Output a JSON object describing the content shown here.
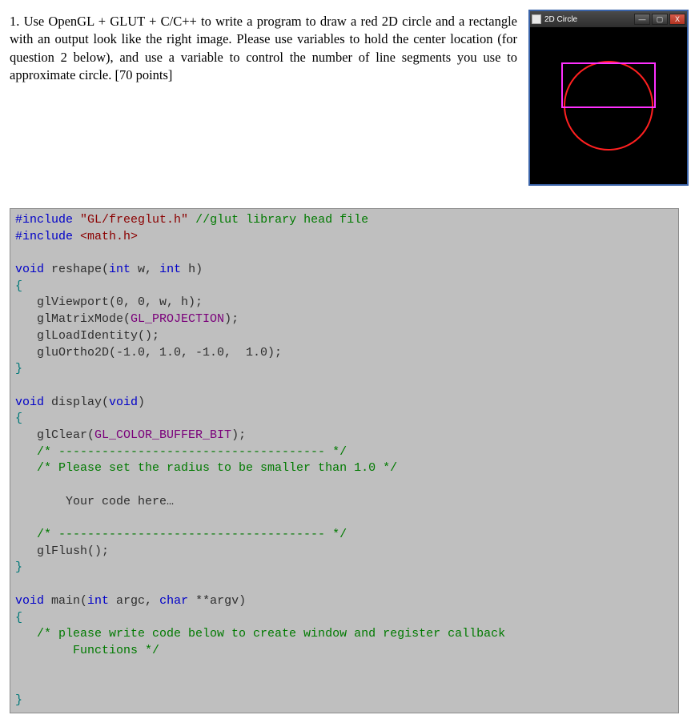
{
  "question": {
    "number": "1.",
    "body": "Use OpenGL + GLUT + C/C++ to write a program to draw a red 2D circle and a rectangle with an output look like the right image. Please use variables to hold the center location (for question 2 below), and use a variable to control the number of line segments you use to approximate circle. [70 points]"
  },
  "window": {
    "title": "2D Circle",
    "min_label": "—",
    "max_label": "▢",
    "close_label": "X"
  },
  "shapes": {
    "circle_color": "#ff2020",
    "rect_color": "#ff30ff",
    "bg": "#000000"
  },
  "code": {
    "l1_kw": "#include",
    "l1_str": "\"GL/freeglut.h\"",
    "l1_cm": " //glut library head file",
    "l2_kw": "#include",
    "l2_inc": " <math.h>",
    "l3": "",
    "l4a": "void",
    "l4b": " reshape(",
    "l4c": "int",
    "l4d": " w, ",
    "l4e": "int",
    "l4f": " h)",
    "l5": "{",
    "l6": "   glViewport(0, 0, w, h);",
    "l7a": "   glMatrixMode(",
    "l7b": "GL_PROJECTION",
    "l7c": ");",
    "l8": "   glLoadIdentity();",
    "l9": "   gluOrtho2D(-1.0, 1.0, -1.0,  1.0);",
    "l10": "}",
    "l11": "",
    "l12a": "void",
    "l12b": " display(",
    "l12c": "void",
    "l12d": ")",
    "l13": "{",
    "l14a": "   glClear(",
    "l14b": "GL_COLOR_BUFFER_BIT",
    "l14c": ");",
    "l15": "   /* ------------------------------------- */",
    "l16": "   /* Please set the radius to be smaller than 1.0 */",
    "l17": "",
    "l18": "       Your code here…",
    "l19": "",
    "l20": "   /* ------------------------------------- */",
    "l21": "   glFlush();",
    "l22": "}",
    "l23": "",
    "l24a": "void",
    "l24b": " main(",
    "l24c": "int",
    "l24d": " argc, ",
    "l24e": "char",
    "l24f": " **argv)",
    "l25": "{",
    "l26": "   /* please write code below to create window and register callback",
    "l27": "        Functions */",
    "l28": "",
    "l29": "",
    "l30": "}"
  }
}
